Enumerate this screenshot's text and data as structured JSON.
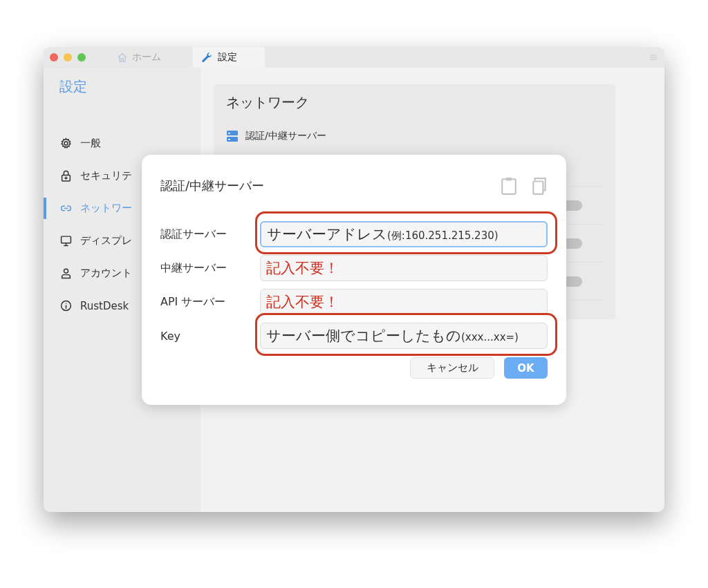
{
  "tabs": [
    {
      "label": "ホーム",
      "selected": false
    },
    {
      "label": "設定",
      "selected": true
    }
  ],
  "sidebar": {
    "title": "設定",
    "items": [
      {
        "label": "一般",
        "selected": false
      },
      {
        "label": "セキュリテ",
        "selected": false
      },
      {
        "label": "ネットワー",
        "selected": true
      },
      {
        "label": "ディスプレ",
        "selected": false
      },
      {
        "label": "アカウント",
        "selected": false
      },
      {
        "label": "RustDesk",
        "selected": false
      }
    ]
  },
  "network": {
    "title": "ネットワーク",
    "server_row": "認証/中継サーバー",
    "toggles": [
      {
        "on": false
      },
      {
        "on": false
      },
      {
        "on": false
      }
    ]
  },
  "dialog": {
    "title": "認証/中継サーバー",
    "fields": [
      {
        "label": "認証サーバー",
        "kind": "entry",
        "value": "サーバーアドレス",
        "hint": "(例:160.251.215.230)",
        "focused": true,
        "highlighted": true
      },
      {
        "label": "中継サーバー",
        "kind": "warning",
        "value": "記入不要！",
        "focused": false,
        "highlighted": false
      },
      {
        "label": "API サーバー",
        "kind": "warning",
        "value": "記入不要！",
        "focused": false,
        "highlighted": false
      },
      {
        "label": "Key",
        "kind": "entry",
        "value": "サーバー側でコピーしたもの",
        "hint": "(xxx...xx=)",
        "focused": false,
        "highlighted": true
      }
    ],
    "buttons": [
      {
        "label": "キャンセル",
        "kind": "secondary"
      },
      {
        "label": "OK",
        "kind": "primary"
      }
    ]
  }
}
